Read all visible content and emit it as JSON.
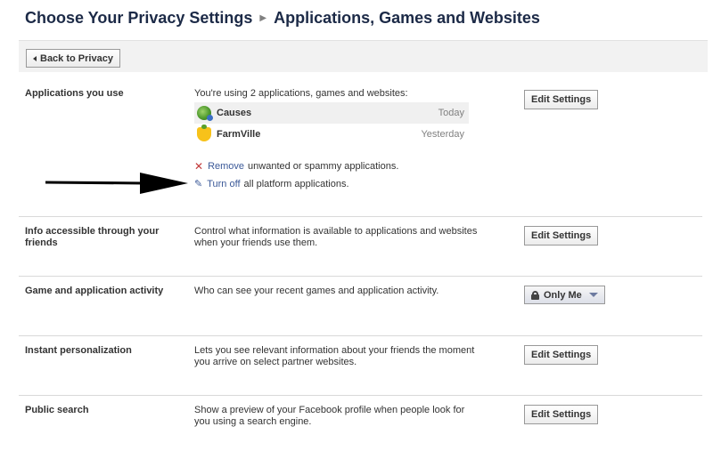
{
  "header": {
    "crumb_root": "Choose Your Privacy Settings",
    "crumb_current": "Applications, Games and Websites"
  },
  "toolbar": {
    "back_label": "Back to Privacy"
  },
  "sections": [
    {
      "title": "Applications you use",
      "desc": "You're using 2 applications, games and websites:",
      "button": "Edit Settings",
      "apps": [
        {
          "name": "Causes",
          "time": "Today",
          "icon": "causes-icon"
        },
        {
          "name": "FarmVille",
          "time": "Yesterday",
          "icon": "farmville-icon"
        }
      ],
      "remove_link": "Remove",
      "remove_text": "unwanted or spammy applications.",
      "turnoff_link": "Turn off",
      "turnoff_text": "all platform applications."
    },
    {
      "title": "Info accessible through your friends",
      "desc": "Control what information is available to applications and websites when your friends use them.",
      "button": "Edit Settings"
    },
    {
      "title": "Game and application activity",
      "desc": "Who can see your recent games and application activity.",
      "dropdown": "Only Me"
    },
    {
      "title": "Instant personalization",
      "desc": "Lets you see relevant information about your friends the moment you arrive on select partner websites.",
      "button": "Edit Settings"
    },
    {
      "title": "Public search",
      "desc": "Show a preview of your Facebook profile when people look for you using a search engine.",
      "button": "Edit Settings"
    }
  ],
  "colors": {
    "link": "#3b5998",
    "title": "#1c2a47",
    "remove": "#c23a3a"
  }
}
